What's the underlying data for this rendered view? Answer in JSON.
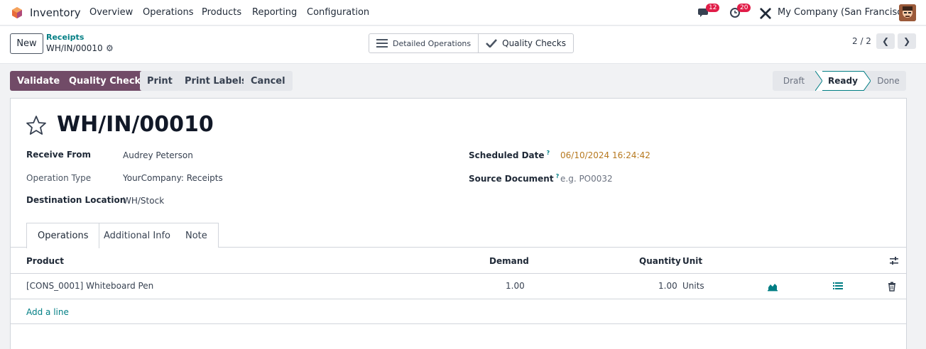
{
  "navbar": {
    "app_name": "Inventory",
    "menu": [
      "Overview",
      "Operations",
      "Products",
      "Reporting",
      "Configuration"
    ],
    "messages_count": "12",
    "activities_count": "20",
    "company": "My Company (San Francisco)",
    "icons": [
      "odoo-app-icon",
      "chat-icon",
      "clock-icon",
      "debug-tools-icon",
      "user-avatar"
    ]
  },
  "control": {
    "new_label": "New",
    "breadcrumb_parent": "Receipts",
    "breadcrumb_current": "WH/IN/00010",
    "smart_buttons": {
      "detailed_ops": "Detailed Operations",
      "quality_checks": "Quality Checks"
    },
    "pager": "2 / 2"
  },
  "actions": {
    "validate": "Validate",
    "quality_checks": "Quality Checks",
    "print": "Print",
    "print_labels": "Print Labels",
    "cancel": "Cancel"
  },
  "status": {
    "stages": [
      "Draft",
      "Ready",
      "Done"
    ],
    "active": "Ready"
  },
  "form": {
    "title": "WH/IN/00010",
    "receive_from_label": "Receive From",
    "receive_from": "Audrey Peterson",
    "operation_type_label": "Operation Type",
    "operation_type": "YourCompany: Receipts",
    "destination_label": "Destination Location",
    "destination": "WH/Stock",
    "scheduled_label": "Scheduled Date",
    "scheduled": "06/10/2024 16:24:42",
    "source_label": "Source Document",
    "source_placeholder": "e.g. PO0032",
    "help_mark": "?"
  },
  "tabs": [
    "Operations",
    "Additional Info",
    "Note"
  ],
  "table": {
    "headers": {
      "product": "Product",
      "demand": "Demand",
      "quantity": "Quantity",
      "unit": "Unit"
    },
    "rows": [
      {
        "product": "[CONS_0001] Whiteboard Pen",
        "demand": "1.00",
        "quantity": "1.00",
        "unit": "Units"
      }
    ],
    "add_line": "Add a line"
  },
  "colors": {
    "primary": "#714b67",
    "link": "#017e84",
    "date": "#b7791f",
    "badge": "#e11d48"
  }
}
